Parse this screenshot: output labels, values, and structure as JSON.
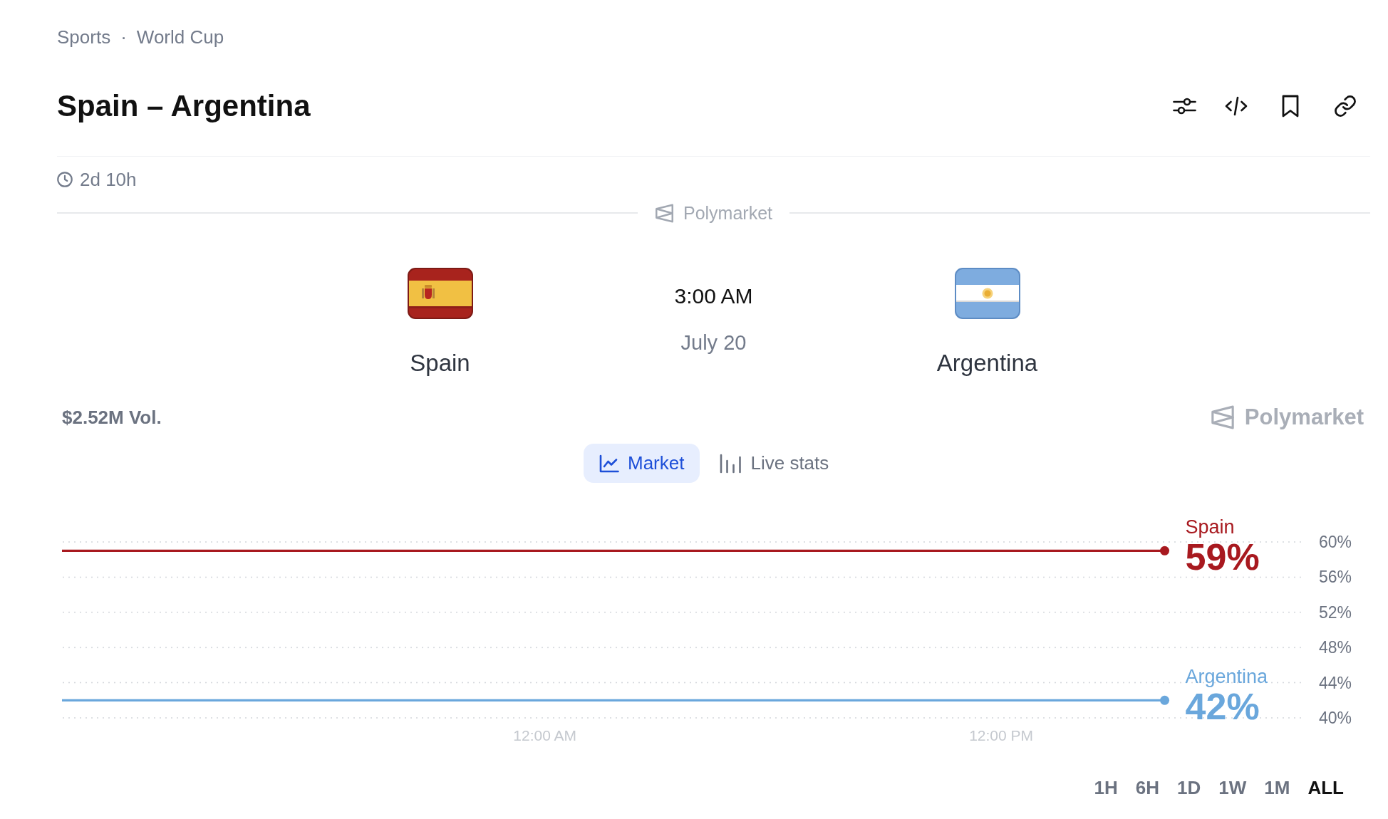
{
  "breadcrumb": {
    "items": [
      "Sports",
      "World Cup"
    ],
    "separator": "·"
  },
  "title": "Spain – Argentina",
  "countdown": "2d 10h",
  "source_divider": {
    "label": "Polymarket"
  },
  "match": {
    "teams": [
      {
        "name": "Spain",
        "kind": "es"
      },
      {
        "name": "Argentina",
        "kind": "ar"
      }
    ],
    "time": "3:00 AM",
    "date": "July 20"
  },
  "volume": "$2.52M Vol.",
  "source_badge": {
    "label": "Polymarket"
  },
  "view_tabs": [
    {
      "label": "Market",
      "kind": "line",
      "selected": true
    },
    {
      "label": "Live stats",
      "kind": "bars",
      "selected": false
    }
  ],
  "market_chart": {
    "chart_data": {
      "type": "line",
      "grid": true,
      "x": [
        -12.7,
        16.3
      ],
      "xlim": [
        -12.7,
        20
      ],
      "ylim": [
        40,
        60
      ],
      "xticks": [
        {
          "value": 0,
          "label": "12:00 AM"
        },
        {
          "value": 12,
          "label": "12:00 PM"
        }
      ],
      "yticks": [
        {
          "value": 60,
          "label": "60%"
        },
        {
          "value": 56,
          "label": "56%"
        },
        {
          "value": 52,
          "label": "52%"
        },
        {
          "value": 48,
          "label": "48%"
        },
        {
          "value": 44,
          "label": "44%"
        },
        {
          "value": 40,
          "label": "40%"
        }
      ],
      "series": [
        {
          "name": "Spain",
          "color": "#a8191f",
          "values": [
            59,
            59
          ]
        },
        {
          "name": "Argentina",
          "color": "#6aa7dc",
          "values": [
            42,
            42
          ]
        }
      ],
      "annotations": [
        {
          "x": 16.3,
          "y": 59,
          "text": "59%"
        },
        {
          "x": 16.3,
          "y": 42,
          "text": "42%"
        }
      ]
    }
  },
  "ranges": [
    {
      "label": "1H",
      "selected": false
    },
    {
      "label": "6H",
      "selected": false
    },
    {
      "label": "1D",
      "selected": false
    },
    {
      "label": "1W",
      "selected": false
    },
    {
      "label": "1M",
      "selected": false
    },
    {
      "label": "ALL",
      "selected": true
    }
  ]
}
